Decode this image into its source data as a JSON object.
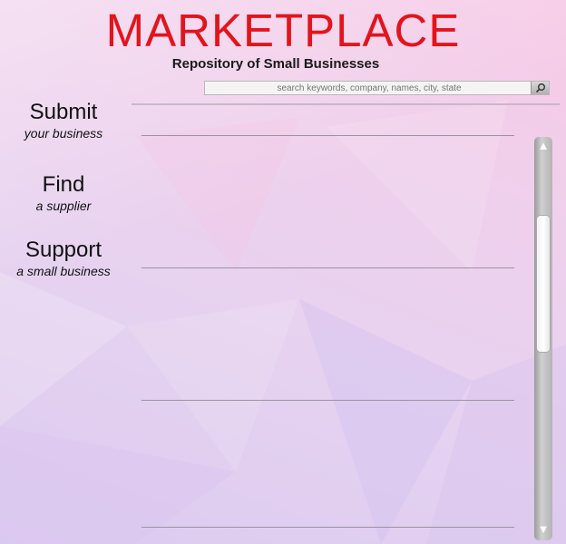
{
  "header": {
    "logo_text": "MARKETPLACE",
    "subtitle": "Repository of Small Businesses"
  },
  "search": {
    "placeholder": "search keywords, company, names, city, state",
    "button_icon": "search-icon"
  },
  "nav": [
    {
      "title": "Submit",
      "subtitle": "your business"
    },
    {
      "title": "Find",
      "subtitle": "a supplier"
    },
    {
      "title": "Support",
      "subtitle": "a small business"
    }
  ],
  "scrollbar": {
    "up_icon": "up-arrow-icon",
    "down_icon": "down-arrow-icon",
    "up_glyph": "▲",
    "down_glyph": "▼"
  },
  "colors": {
    "brand": "#e3141c"
  }
}
